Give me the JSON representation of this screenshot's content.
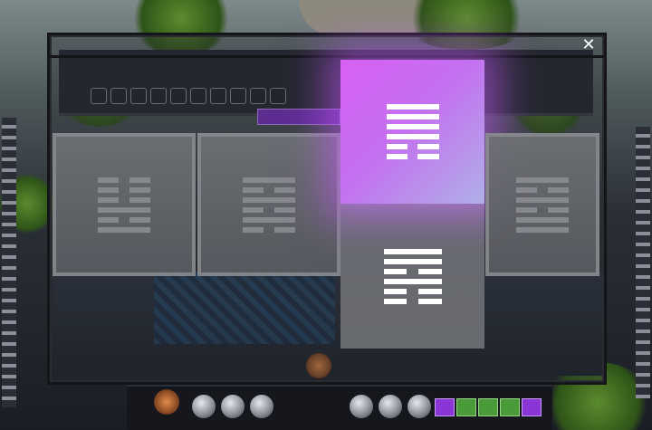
{
  "modal": {
    "close_label": "✕"
  },
  "cards": [
    {
      "id": "card-1",
      "lines": [
        0,
        0,
        0,
        1,
        0,
        1
      ]
    },
    {
      "id": "card-2",
      "lines": [
        1,
        0,
        1,
        0,
        1,
        0
      ]
    },
    {
      "id": "card-3-selected",
      "lines": [
        1,
        1,
        1,
        1,
        0,
        0
      ],
      "selected": true
    },
    {
      "id": "card-3-preview",
      "lines": [
        1,
        1,
        0,
        1,
        0,
        0
      ]
    },
    {
      "id": "card-4",
      "lines": [
        1,
        0,
        1,
        0,
        1,
        1
      ]
    }
  ],
  "colors": {
    "selected_glow": "#d860f5",
    "card_gray": "#6f7276",
    "card_border": "#8a8c90",
    "hex_gray": "#8e9095",
    "hex_white": "#ffffff"
  }
}
